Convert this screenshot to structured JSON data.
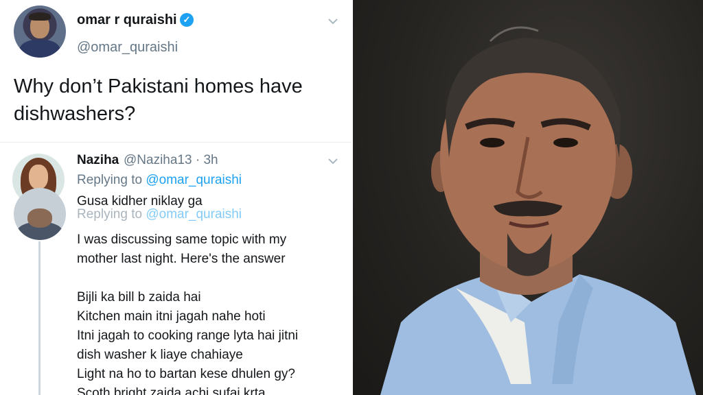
{
  "main_tweet": {
    "name": "omar r quraishi",
    "verified_icon": "verified-badge-icon",
    "handle": "@omar_quraishi",
    "text": "Why don’t Pakistani homes have dishwashers?"
  },
  "reply_1": {
    "name": "Naziha",
    "handle_time": "@Naziha13 · 3h",
    "replying_prefix": "Replying to ",
    "replying_handle": "@omar_quraishi",
    "text": "Gusa kidher niklay ga"
  },
  "reply_2": {
    "replying_prefix": "Replying to ",
    "replying_handle": "@omar_quraishi",
    "lines": [
      "I was discussing same topic with my",
      "mother last night. Here's the answer",
      "",
      "Bijli ka  bill b zaida hai",
      "Kitchen main itni jagah nahe hoti",
      "Itni jagah to cooking range lyta hai jitni",
      "dish washer k liaye chahiaye",
      "Light na ho to bartan kese dhulen gy?",
      "Scoth bright zaida achi sufai krta"
    ]
  },
  "colors": {
    "link_blue": "#1da1f2",
    "secondary_gray": "#657786",
    "text_dark": "#14171a",
    "thread_line": "#ccd6dd"
  },
  "icons": [
    "chevron-down-icon",
    "verified-badge-icon"
  ]
}
